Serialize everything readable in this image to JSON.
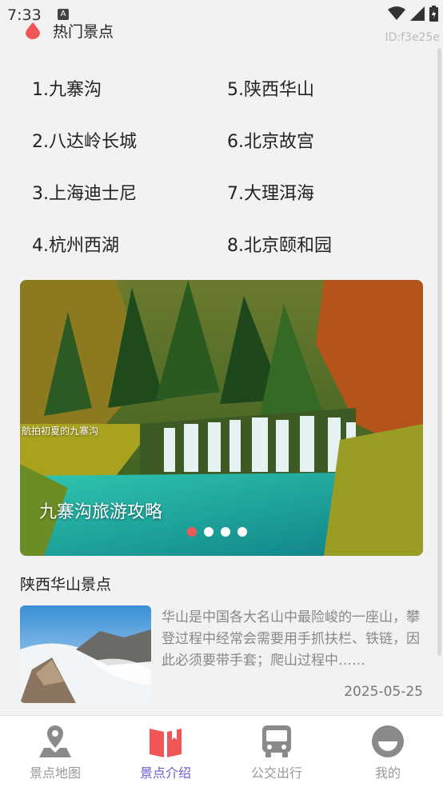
{
  "status_bar": {
    "time": "7:33",
    "notification_glyph": "A",
    "watermark": "ID:f3e25e"
  },
  "header": {
    "title": "热门景点",
    "accent_color": "#f25555"
  },
  "spots": [
    "1.九寨沟",
    "2.八达岭长城",
    "3.上海迪士尼",
    "4.杭州西湖",
    "5.陕西华山",
    "6.北京故宫",
    "7.大理洱海",
    "8.北京颐和园"
  ],
  "banner": {
    "small_caption": "航拍初夏的九寨沟",
    "caption": "九寨沟旅游攻略",
    "dots_total": 4,
    "active_dot": 0
  },
  "section": {
    "title": "陕西华山景点",
    "article": {
      "description": "华山是中国各大名山中最险峻的一座山，攀登过程中经常会需要用手抓扶栏、铁链，因此必须要带手套；爬山过程中……",
      "date": "2025-05-25"
    }
  },
  "tabs": [
    {
      "label": "景点地图",
      "icon": "map-pin-icon",
      "active": false
    },
    {
      "label": "景点介绍",
      "icon": "book-icon",
      "active": true
    },
    {
      "label": "公交出行",
      "icon": "bus-icon",
      "active": false
    },
    {
      "label": "我的",
      "icon": "profile-icon",
      "active": false
    }
  ],
  "colors": {
    "active_tab": "#6a5acd",
    "inactive_tab": "#999999",
    "dot_active": "#f05a5a"
  }
}
